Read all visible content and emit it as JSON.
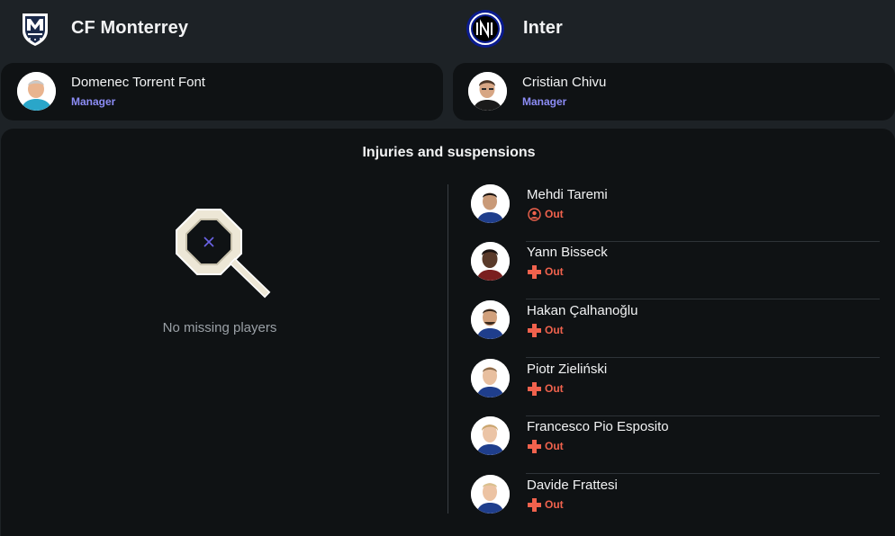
{
  "teams": {
    "home": {
      "name": "CF Monterrey",
      "logo_icon": "monterrey-crest-icon"
    },
    "away": {
      "name": "Inter",
      "logo_icon": "inter-crest-icon"
    }
  },
  "managers": {
    "home": {
      "name": "Domenec Torrent Font",
      "role": "Manager"
    },
    "away": {
      "name": "Cristian Chivu",
      "role": "Manager"
    }
  },
  "injuries": {
    "title": "Injuries and suspensions",
    "home": {
      "empty_text": "No missing players",
      "illustration_icon": "magnifier-empty-icon"
    },
    "away": [
      {
        "name": "Mehdi Taremi",
        "status": "Out",
        "reason_icon": "person-circle-icon"
      },
      {
        "name": "Yann Bisseck",
        "status": "Out",
        "reason_icon": "injury-cross-icon"
      },
      {
        "name": "Hakan Çalhanoğlu",
        "status": "Out",
        "reason_icon": "injury-cross-icon"
      },
      {
        "name": "Piotr Zieliński",
        "status": "Out",
        "reason_icon": "injury-cross-icon"
      },
      {
        "name": "Francesco Pio Esposito",
        "status": "Out",
        "reason_icon": "injury-cross-icon"
      },
      {
        "name": "Davide Frattesi",
        "status": "Out",
        "reason_icon": "injury-cross-icon"
      }
    ]
  },
  "colors": {
    "background": "#1d2226",
    "card": "#0f1214",
    "role_accent": "#8c8cf5",
    "status_out": "#f0624d"
  }
}
